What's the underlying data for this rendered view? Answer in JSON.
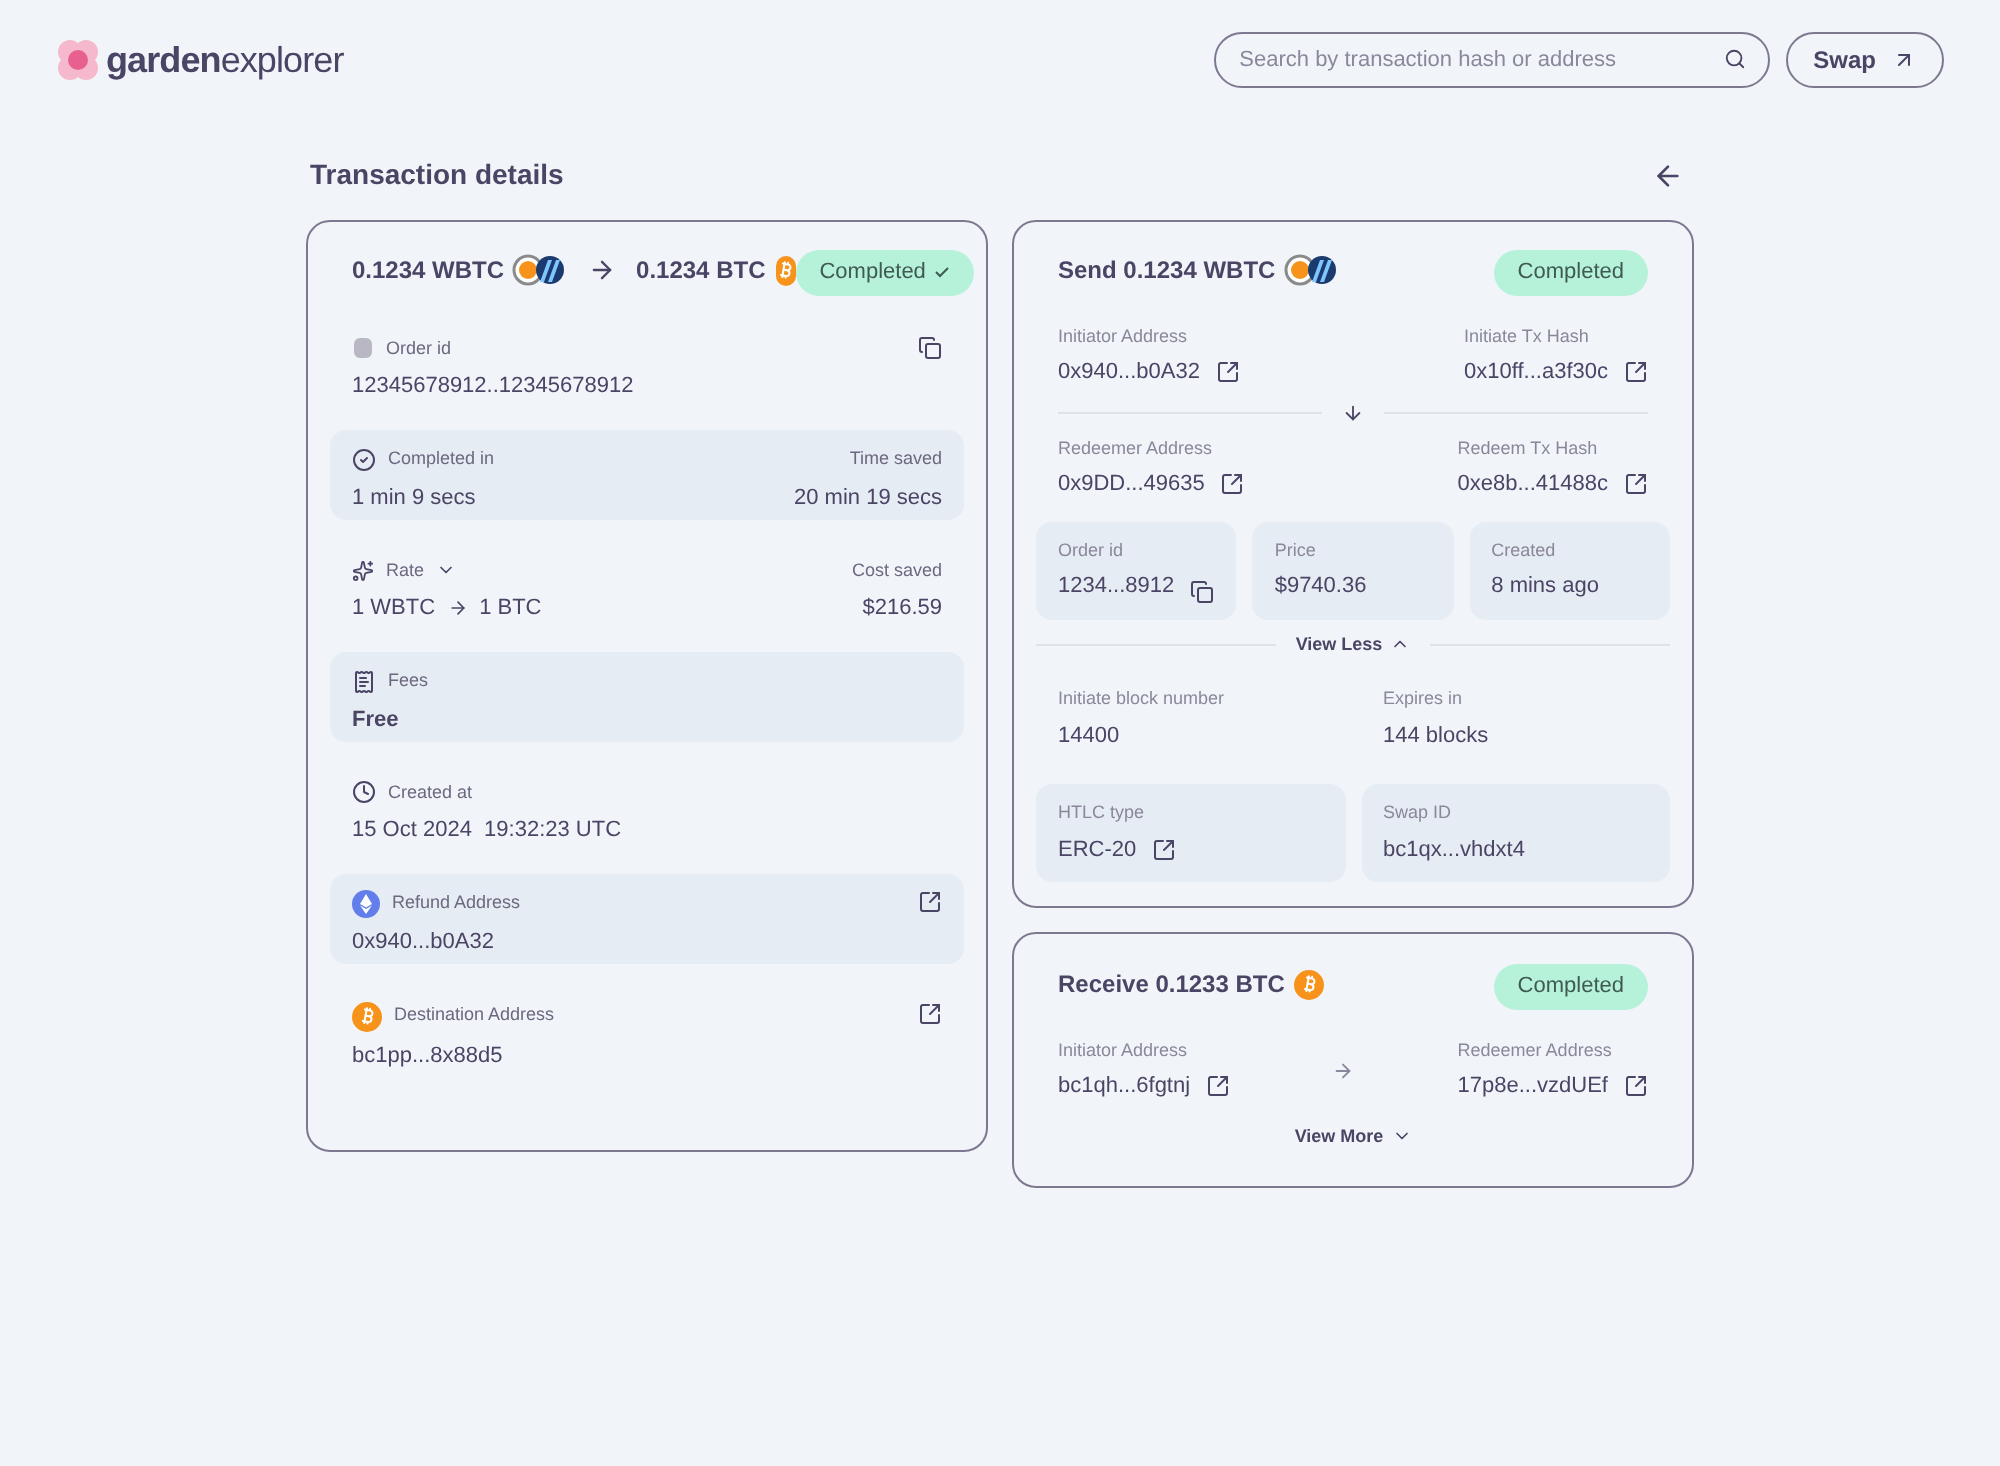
{
  "header": {
    "logo": {
      "brand": "garden",
      "suffix": "explorer"
    },
    "search": {
      "placeholder": "Search by transaction hash or address"
    },
    "swap_button": "Swap"
  },
  "page_title": "Transaction details",
  "summary": {
    "from_amount": "0.1234 WBTC",
    "to_amount": "0.1234 BTC",
    "status": "Completed",
    "rows": [
      {
        "kind": "order",
        "label": "Order id",
        "value": "12345678912..12345678912",
        "copyable": true
      },
      {
        "kind": "duration",
        "label": "Completed in",
        "value": "1 min 9 secs",
        "secondary_label": "Time saved",
        "secondary_value": "20 min 19 secs"
      },
      {
        "kind": "rate",
        "label": "Rate",
        "value_from": "1 WBTC",
        "value_to": "1 BTC",
        "secondary_label": "Cost saved",
        "secondary_value": "$216.59"
      },
      {
        "kind": "fees",
        "label": "Fees",
        "value": "Free"
      },
      {
        "kind": "created",
        "label": "Created at",
        "value": "15 Oct 2024  19:32:23 UTC"
      },
      {
        "kind": "refund",
        "label": "Refund Address",
        "value": "0x940...b0A32",
        "external_link": true
      },
      {
        "kind": "destination",
        "label": "Destination Address",
        "value": "bc1pp...8x88d5",
        "external_link": true
      }
    ]
  },
  "send": {
    "title": "Send 0.1234 WBTC",
    "status": "Completed",
    "initiator": {
      "label": "Initiator Address",
      "value": "0x940...b0A32"
    },
    "initiate_tx": {
      "label": "Initiate Tx Hash",
      "value": "0x10ff...a3f30c"
    },
    "redeemer": {
      "label": "Redeemer Address",
      "value": "0x9DD...49635"
    },
    "redeem_tx": {
      "label": "Redeem Tx Hash",
      "value": "0xe8b...41488c"
    },
    "tiles": [
      {
        "label": "Order id",
        "value": "1234...8912",
        "copyable": true
      },
      {
        "label": "Price",
        "value": "$9740.36"
      },
      {
        "label": "Created",
        "value": "8 mins ago"
      }
    ],
    "toggle": {
      "label": "View Less",
      "expanded": true
    },
    "details": [
      {
        "label": "Initiate block number",
        "value": "14400"
      },
      {
        "label": "Expires in",
        "value": "144 blocks"
      },
      {
        "label": "HTLC type",
        "value": "ERC-20",
        "external_link": true
      },
      {
        "label": "Swap ID",
        "value": "bc1qx...vhdxt4"
      }
    ]
  },
  "receive": {
    "title": "Receive 0.1233 BTC",
    "status": "Completed",
    "initiator": {
      "label": "Initiator Address",
      "value": "bc1qh...6fgtnj"
    },
    "redeemer": {
      "label": "Redeemer Address",
      "value": "17p8e...vzdUEf"
    },
    "toggle": {
      "label": "View More",
      "expanded": false
    }
  }
}
